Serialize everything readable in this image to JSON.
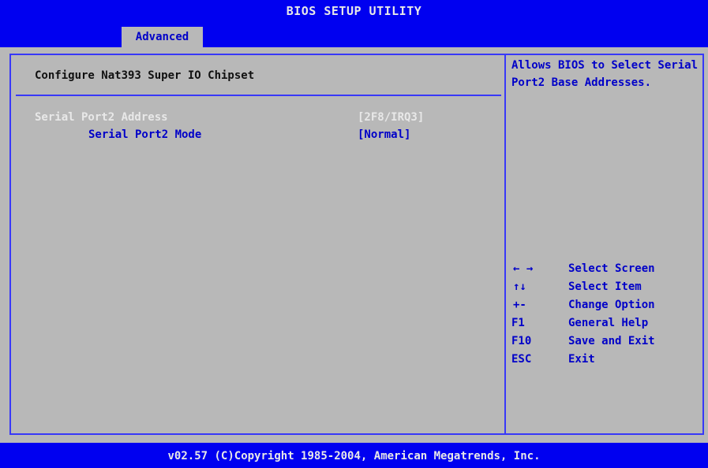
{
  "title_bar": {
    "text": "BIOS SETUP UTILITY"
  },
  "menu": {
    "active_tab": "Advanced"
  },
  "main": {
    "section_title": "Configure Nat393 Super IO Chipset",
    "items": [
      {
        "label": "Serial Port2 Address",
        "value": "[2F8/IRQ3]"
      },
      {
        "label": "Serial Port2 Mode",
        "value": "[Normal]"
      }
    ]
  },
  "help": {
    "text": "Allows BIOS to Select Serial Port2 Base Addresses."
  },
  "legend": [
    {
      "key": "← →",
      "key_icon": "left-right-arrows-icon",
      "action": "Select Screen"
    },
    {
      "key": "↑↓",
      "key_icon": "up-down-arrows-icon",
      "action": "Select Item"
    },
    {
      "key": "+-",
      "action": "Change Option"
    },
    {
      "key": "F1",
      "action": "General Help"
    },
    {
      "key": "F10",
      "action": "Save and Exit"
    },
    {
      "key": "ESC",
      "action": "Exit"
    }
  ],
  "footer": {
    "text": "v02.57 (C)Copyright 1985-2004, American Megatrends, Inc."
  },
  "colors": {
    "bar_blue": "#0000f0",
    "panel_gray": "#b8b8b8",
    "text_blue": "#0000c8",
    "text_white": "#e8e8e8",
    "frame_blue": "#3838f8"
  }
}
